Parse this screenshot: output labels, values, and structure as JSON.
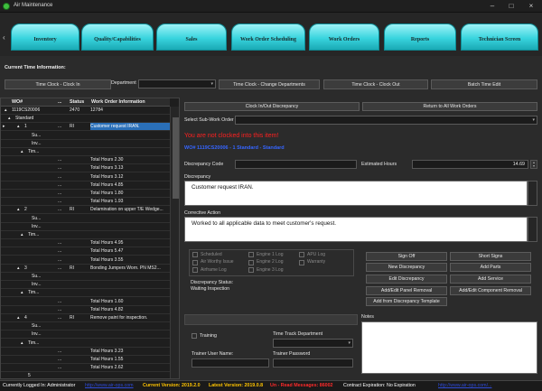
{
  "window": {
    "title": "Air Maintenance"
  },
  "tabs": [
    "Inventory",
    "Quality/Capabilities",
    "Sales",
    "Work Order Scheduling",
    "Work Orders",
    "Reports",
    "Technician Screen"
  ],
  "time_section": {
    "label": "Current Time Information:",
    "clock_in_label": "Time Clock - Clock In",
    "department_label": "Department",
    "change_dept_label": "Time Clock - Change Departments",
    "clock_out_label": "Time Clock - Clock Out",
    "batch_edit_label": "Batch Time Edit"
  },
  "grid": {
    "headers": {
      "wo": "WO#",
      "dots": "...",
      "status": "Status",
      "info": "Work Order Information"
    },
    "rows": [
      {
        "indent": 4,
        "exp": "▴",
        "wo": "1119CS20006",
        "dots": "",
        "status": "2470",
        "info": "12784"
      },
      {
        "indent": 8,
        "exp": "▴",
        "wo": "Standard",
        "dots": "",
        "status": "",
        "info": ""
      },
      {
        "indent": 18,
        "exp": "▴",
        "wo": "1",
        "dots": "...",
        "status": "RI",
        "info": "Customer request IRAN.",
        "selected": true
      },
      {
        "indent": 26,
        "exp": "",
        "wo": "Su...",
        "dots": "",
        "status": "",
        "info": ""
      },
      {
        "indent": 26,
        "exp": "",
        "wo": "Inv...",
        "dots": "",
        "status": "",
        "info": ""
      },
      {
        "indent": 22,
        "exp": "▴",
        "wo": "Tim...",
        "dots": "",
        "status": "",
        "info": ""
      },
      {
        "indent": 52,
        "exp": "",
        "wo": "",
        "dots": "...",
        "status": "",
        "info": "Total Hours 2.30"
      },
      {
        "indent": 52,
        "exp": "",
        "wo": "",
        "dots": "...",
        "status": "",
        "info": "Total Hours 3.13"
      },
      {
        "indent": 52,
        "exp": "",
        "wo": "",
        "dots": "...",
        "status": "",
        "info": "Total Hours 3.12"
      },
      {
        "indent": 52,
        "exp": "",
        "wo": "",
        "dots": "...",
        "status": "",
        "info": "Total Hours 4.85"
      },
      {
        "indent": 52,
        "exp": "",
        "wo": "",
        "dots": "...",
        "status": "",
        "info": "Total Hours 1.80"
      },
      {
        "indent": 52,
        "exp": "",
        "wo": "",
        "dots": "...",
        "status": "",
        "info": "Total Hours 1.93"
      },
      {
        "indent": 18,
        "exp": "▴",
        "wo": "2",
        "dots": "...",
        "status": "RI",
        "info": "Delamination on upper T/E Wedge..."
      },
      {
        "indent": 26,
        "exp": "",
        "wo": "Su...",
        "dots": "",
        "status": "",
        "info": ""
      },
      {
        "indent": 26,
        "exp": "",
        "wo": "Inv...",
        "dots": "",
        "status": "",
        "info": ""
      },
      {
        "indent": 22,
        "exp": "▴",
        "wo": "Tim...",
        "dots": "",
        "status": "",
        "info": ""
      },
      {
        "indent": 52,
        "exp": "",
        "wo": "",
        "dots": "...",
        "status": "",
        "info": "Total Hours 4.95"
      },
      {
        "indent": 52,
        "exp": "",
        "wo": "",
        "dots": "...",
        "status": "",
        "info": "Total Hours 5.47"
      },
      {
        "indent": 52,
        "exp": "",
        "wo": "",
        "dots": "...",
        "status": "",
        "info": "Total Hours 3.55"
      },
      {
        "indent": 18,
        "exp": "▴",
        "wo": "3",
        "dots": "...",
        "status": "RI",
        "info": "Bonding Jumpers Worn.   PN MS2..."
      },
      {
        "indent": 26,
        "exp": "",
        "wo": "Su...",
        "dots": "",
        "status": "",
        "info": ""
      },
      {
        "indent": 26,
        "exp": "",
        "wo": "Inv...",
        "dots": "",
        "status": "",
        "info": ""
      },
      {
        "indent": 22,
        "exp": "▴",
        "wo": "Tim...",
        "dots": "",
        "status": "",
        "info": ""
      },
      {
        "indent": 52,
        "exp": "",
        "wo": "",
        "dots": "...",
        "status": "",
        "info": "Total Hours 1.60"
      },
      {
        "indent": 52,
        "exp": "",
        "wo": "",
        "dots": "...",
        "status": "",
        "info": "Total Hours 4.82"
      },
      {
        "indent": 18,
        "exp": "▴",
        "wo": "4",
        "dots": "...",
        "status": "RI",
        "info": "Remove paint for inspection."
      },
      {
        "indent": 26,
        "exp": "",
        "wo": "Su...",
        "dots": "",
        "status": "",
        "info": ""
      },
      {
        "indent": 26,
        "exp": "",
        "wo": "Inv...",
        "dots": "",
        "status": "",
        "info": ""
      },
      {
        "indent": 22,
        "exp": "▴",
        "wo": "Tim...",
        "dots": "",
        "status": "",
        "info": ""
      },
      {
        "indent": 52,
        "exp": "",
        "wo": "",
        "dots": "...",
        "status": "",
        "info": "Total Hours 3.23"
      },
      {
        "indent": 52,
        "exp": "",
        "wo": "",
        "dots": "...",
        "status": "",
        "info": "Total Hours 1.55"
      },
      {
        "indent": 52,
        "exp": "",
        "wo": "",
        "dots": "...",
        "status": "",
        "info": "Total Hours 2.62"
      },
      {
        "indent": 22,
        "exp": "",
        "wo": "5",
        "dots": "",
        "status": "",
        "info": ""
      }
    ]
  },
  "detail": {
    "clock_discrepancy_label": "Clock In/Out Discrepancy",
    "return_all_label": "Return to All Work Orders",
    "select_sub_label": "Select Sub-Work Order",
    "not_clocked_msg": "You are not clocked into this item!",
    "wo_blue_text": "WO# 1119CS20006 - 1 Standard - Standard",
    "discrepancy_code_label": "Discrepancy Code",
    "estimated_hours_label": "Estimated Hours",
    "estimated_hours_value": "14.69",
    "discrepancy_label": "Discrepancy",
    "discrepancy_text": "Customer request IRAN.",
    "corrective_label": "Corrective Action",
    "corrective_text": "Worked to all applicable data to meet customer's request.",
    "checks": [
      "Scheduled",
      "Engine 1 Log",
      "APU Log",
      "Air Worthy Issue",
      "Engine 2 Log",
      "Warranty",
      "Airframe Log",
      "Engine 3 Log"
    ],
    "status_label": "Discrepancy Status:",
    "status_value": "Waiting Inspection",
    "actions": [
      "Sign Off",
      "Short Signs",
      "New Discrepancy",
      "Add Parts",
      "Edit Discrepancy",
      "Add Service",
      "Add/Edit Panel Removal",
      "Add/Edit Component Removal",
      "Add from Discrepancy Template"
    ],
    "notes_label": "Notes",
    "training_label": "Training",
    "time_track_label": "Time Track Department",
    "trainer_user_label": "Trainer User Name:",
    "trainer_pass_label": "Trainer Password"
  },
  "statusbar": {
    "logged_in": "Currently Logged In: Administrator",
    "link1": "http://www.air-ops.com",
    "version": "Current Version: 2019.2.0",
    "latest": "Latest Version: 2019.0.8",
    "unread": "Un - Read Messages: 86002",
    "contract": "Contract Expiration: No Expiration",
    "link2": "http://www.air-ops.com/..."
  }
}
